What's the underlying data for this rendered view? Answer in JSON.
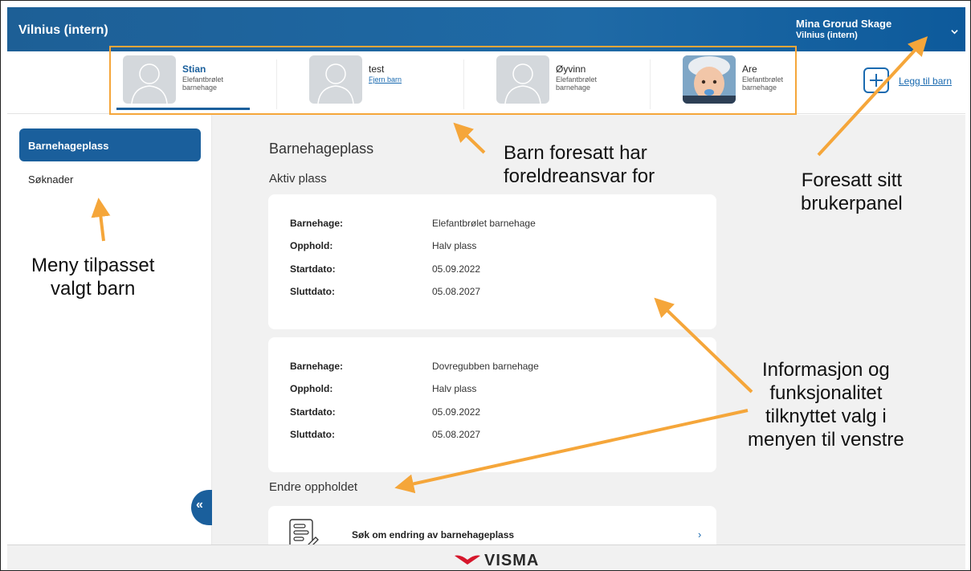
{
  "app": {
    "title": "Vilnius (intern)"
  },
  "user": {
    "name": "Mina Grorud Skage",
    "org": "Vilnius (intern)",
    "menu_icon": "chevron-down-icon"
  },
  "children": [
    {
      "name": "Stian",
      "sub": "Elefantbrølet barnehage",
      "active": true,
      "avatar": "default"
    },
    {
      "name": "test",
      "sub": "Fjern barn",
      "active": false,
      "avatar": "default",
      "sub_is_link": true
    },
    {
      "name": "Øyvinn",
      "sub": "Elefantbrølet barnehage",
      "active": false,
      "avatar": "default"
    },
    {
      "name": "Are",
      "sub": "Elefantbrølet barnehage",
      "active": false,
      "avatar": "photo"
    }
  ],
  "add_child": {
    "label": "Legg til barn",
    "icon": "plus-icon"
  },
  "sidebar": {
    "items": [
      {
        "label": "Barnehageplass",
        "active": true
      },
      {
        "label": "Søknader",
        "active": false
      }
    ],
    "collapse_label": "«"
  },
  "main": {
    "title": "Barnehageplass",
    "active_section": "Aktiv plass",
    "placements": [
      {
        "rows": [
          {
            "k": "Barnehage:",
            "v": "Elefantbrølet barnehage"
          },
          {
            "k": "Opphold:",
            "v": "Halv plass"
          },
          {
            "k": "Startdato:",
            "v": "05.09.2022"
          },
          {
            "k": "Sluttdato:",
            "v": "05.08.2027"
          }
        ]
      },
      {
        "rows": [
          {
            "k": "Barnehage:",
            "v": "Dovregubben barnehage"
          },
          {
            "k": "Opphold:",
            "v": "Halv plass"
          },
          {
            "k": "Startdato:",
            "v": "05.09.2022"
          },
          {
            "k": "Sluttdato:",
            "v": "05.08.2027"
          }
        ]
      }
    ],
    "change_section": "Endre oppholdet",
    "change_action": {
      "label": "Søk om endring av barnehageplass",
      "chevron": "›"
    }
  },
  "footer": {
    "logo": "VISMA"
  },
  "annotations": {
    "children": [
      "Barn foresatt har",
      "foreldreansvar for"
    ],
    "userpanel": [
      "Foresatt sitt",
      "brukerpanel"
    ],
    "menu": [
      "Meny tilpasset",
      "valgt barn"
    ],
    "info": [
      "Informasjon og",
      "funksjonalitet",
      "tilknyttet valg i",
      "menyen til venstre"
    ]
  },
  "colors": {
    "primary": "#1a5f9c",
    "annotation": "#f5a63a",
    "background": "#f1f1f1"
  }
}
